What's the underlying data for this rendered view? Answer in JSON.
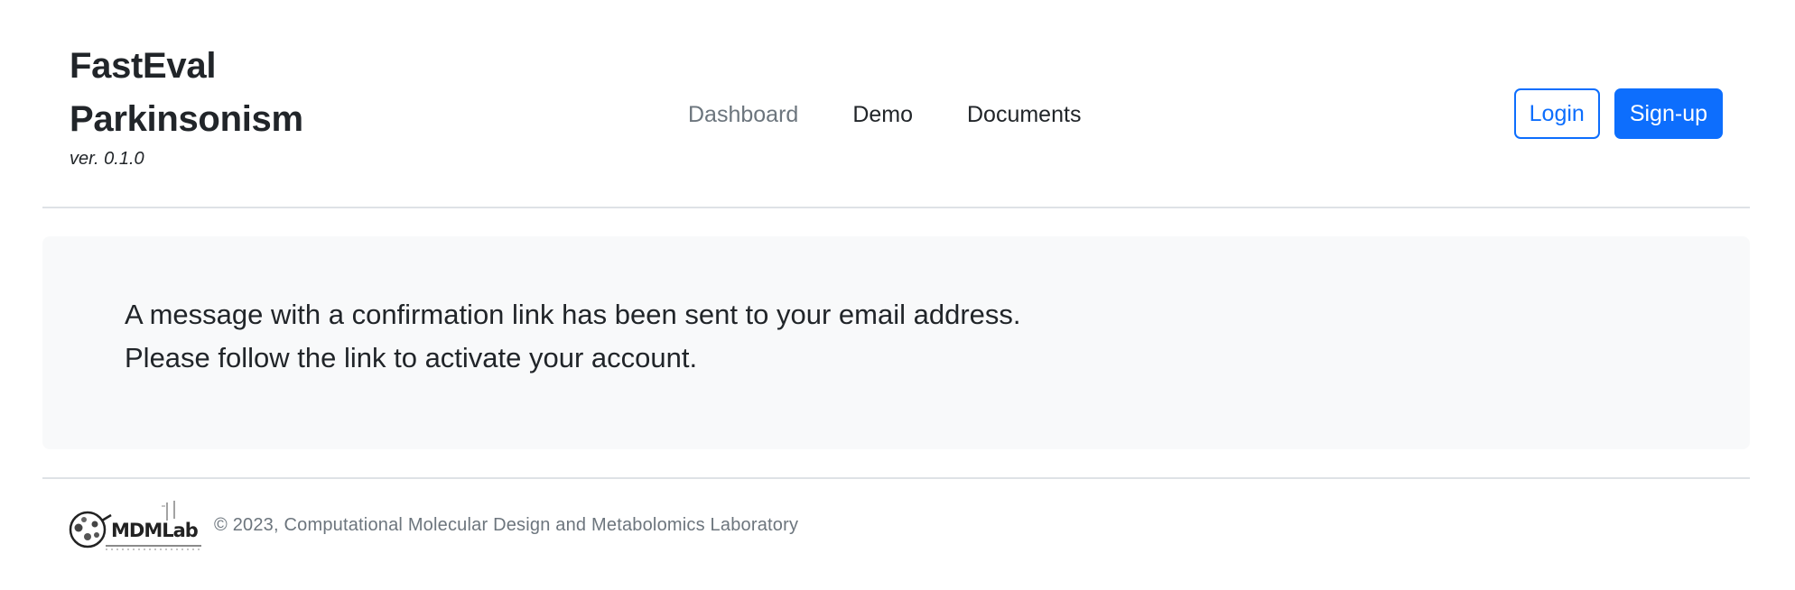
{
  "brand": {
    "title_line1": "FastEval",
    "title_line2": "Parkinsonism",
    "version": "ver. 0.1.0"
  },
  "nav": {
    "items": [
      {
        "label": "Dashboard",
        "active": true
      },
      {
        "label": "Demo",
        "active": false
      },
      {
        "label": "Documents",
        "active": false
      }
    ]
  },
  "auth": {
    "login_label": "Login",
    "signup_label": "Sign-up"
  },
  "message": {
    "line1": "A message with a confirmation link has been sent to your email address.",
    "line2": "Please follow the link to activate your account."
  },
  "footer": {
    "logo_text": "MDMLab",
    "copyright": "© 2023, Computational Molecular Design and Metabolomics Laboratory"
  },
  "colors": {
    "primary": "#0d6efd",
    "text": "#212529",
    "muted": "#6c757d",
    "panel_bg": "#f8f9fa",
    "divider": "#dee2e6"
  }
}
